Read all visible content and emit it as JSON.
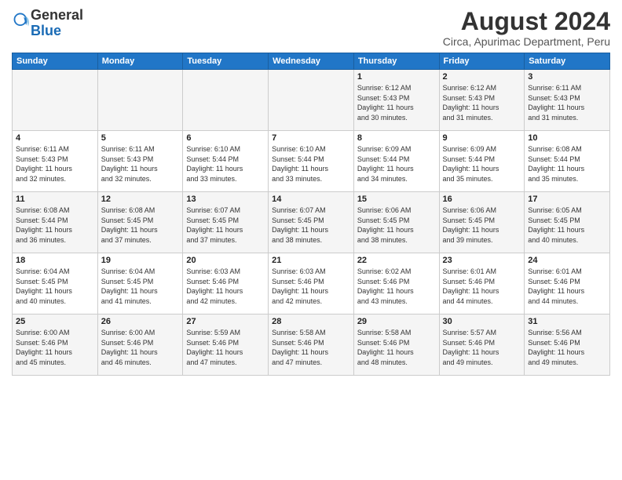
{
  "header": {
    "logo_general": "General",
    "logo_blue": "Blue",
    "title": "August 2024",
    "subtitle": "Circa, Apurimac Department, Peru"
  },
  "days_of_week": [
    "Sunday",
    "Monday",
    "Tuesday",
    "Wednesday",
    "Thursday",
    "Friday",
    "Saturday"
  ],
  "weeks": [
    [
      {
        "day": "",
        "info": ""
      },
      {
        "day": "",
        "info": ""
      },
      {
        "day": "",
        "info": ""
      },
      {
        "day": "",
        "info": ""
      },
      {
        "day": "1",
        "info": "Sunrise: 6:12 AM\nSunset: 5:43 PM\nDaylight: 11 hours\nand 30 minutes."
      },
      {
        "day": "2",
        "info": "Sunrise: 6:12 AM\nSunset: 5:43 PM\nDaylight: 11 hours\nand 31 minutes."
      },
      {
        "day": "3",
        "info": "Sunrise: 6:11 AM\nSunset: 5:43 PM\nDaylight: 11 hours\nand 31 minutes."
      }
    ],
    [
      {
        "day": "4",
        "info": "Sunrise: 6:11 AM\nSunset: 5:43 PM\nDaylight: 11 hours\nand 32 minutes."
      },
      {
        "day": "5",
        "info": "Sunrise: 6:11 AM\nSunset: 5:43 PM\nDaylight: 11 hours\nand 32 minutes."
      },
      {
        "day": "6",
        "info": "Sunrise: 6:10 AM\nSunset: 5:44 PM\nDaylight: 11 hours\nand 33 minutes."
      },
      {
        "day": "7",
        "info": "Sunrise: 6:10 AM\nSunset: 5:44 PM\nDaylight: 11 hours\nand 33 minutes."
      },
      {
        "day": "8",
        "info": "Sunrise: 6:09 AM\nSunset: 5:44 PM\nDaylight: 11 hours\nand 34 minutes."
      },
      {
        "day": "9",
        "info": "Sunrise: 6:09 AM\nSunset: 5:44 PM\nDaylight: 11 hours\nand 35 minutes."
      },
      {
        "day": "10",
        "info": "Sunrise: 6:08 AM\nSunset: 5:44 PM\nDaylight: 11 hours\nand 35 minutes."
      }
    ],
    [
      {
        "day": "11",
        "info": "Sunrise: 6:08 AM\nSunset: 5:44 PM\nDaylight: 11 hours\nand 36 minutes."
      },
      {
        "day": "12",
        "info": "Sunrise: 6:08 AM\nSunset: 5:45 PM\nDaylight: 11 hours\nand 37 minutes."
      },
      {
        "day": "13",
        "info": "Sunrise: 6:07 AM\nSunset: 5:45 PM\nDaylight: 11 hours\nand 37 minutes."
      },
      {
        "day": "14",
        "info": "Sunrise: 6:07 AM\nSunset: 5:45 PM\nDaylight: 11 hours\nand 38 minutes."
      },
      {
        "day": "15",
        "info": "Sunrise: 6:06 AM\nSunset: 5:45 PM\nDaylight: 11 hours\nand 38 minutes."
      },
      {
        "day": "16",
        "info": "Sunrise: 6:06 AM\nSunset: 5:45 PM\nDaylight: 11 hours\nand 39 minutes."
      },
      {
        "day": "17",
        "info": "Sunrise: 6:05 AM\nSunset: 5:45 PM\nDaylight: 11 hours\nand 40 minutes."
      }
    ],
    [
      {
        "day": "18",
        "info": "Sunrise: 6:04 AM\nSunset: 5:45 PM\nDaylight: 11 hours\nand 40 minutes."
      },
      {
        "day": "19",
        "info": "Sunrise: 6:04 AM\nSunset: 5:45 PM\nDaylight: 11 hours\nand 41 minutes."
      },
      {
        "day": "20",
        "info": "Sunrise: 6:03 AM\nSunset: 5:46 PM\nDaylight: 11 hours\nand 42 minutes."
      },
      {
        "day": "21",
        "info": "Sunrise: 6:03 AM\nSunset: 5:46 PM\nDaylight: 11 hours\nand 42 minutes."
      },
      {
        "day": "22",
        "info": "Sunrise: 6:02 AM\nSunset: 5:46 PM\nDaylight: 11 hours\nand 43 minutes."
      },
      {
        "day": "23",
        "info": "Sunrise: 6:01 AM\nSunset: 5:46 PM\nDaylight: 11 hours\nand 44 minutes."
      },
      {
        "day": "24",
        "info": "Sunrise: 6:01 AM\nSunset: 5:46 PM\nDaylight: 11 hours\nand 44 minutes."
      }
    ],
    [
      {
        "day": "25",
        "info": "Sunrise: 6:00 AM\nSunset: 5:46 PM\nDaylight: 11 hours\nand 45 minutes."
      },
      {
        "day": "26",
        "info": "Sunrise: 6:00 AM\nSunset: 5:46 PM\nDaylight: 11 hours\nand 46 minutes."
      },
      {
        "day": "27",
        "info": "Sunrise: 5:59 AM\nSunset: 5:46 PM\nDaylight: 11 hours\nand 47 minutes."
      },
      {
        "day": "28",
        "info": "Sunrise: 5:58 AM\nSunset: 5:46 PM\nDaylight: 11 hours\nand 47 minutes."
      },
      {
        "day": "29",
        "info": "Sunrise: 5:58 AM\nSunset: 5:46 PM\nDaylight: 11 hours\nand 48 minutes."
      },
      {
        "day": "30",
        "info": "Sunrise: 5:57 AM\nSunset: 5:46 PM\nDaylight: 11 hours\nand 49 minutes."
      },
      {
        "day": "31",
        "info": "Sunrise: 5:56 AM\nSunset: 5:46 PM\nDaylight: 11 hours\nand 49 minutes."
      }
    ]
  ]
}
